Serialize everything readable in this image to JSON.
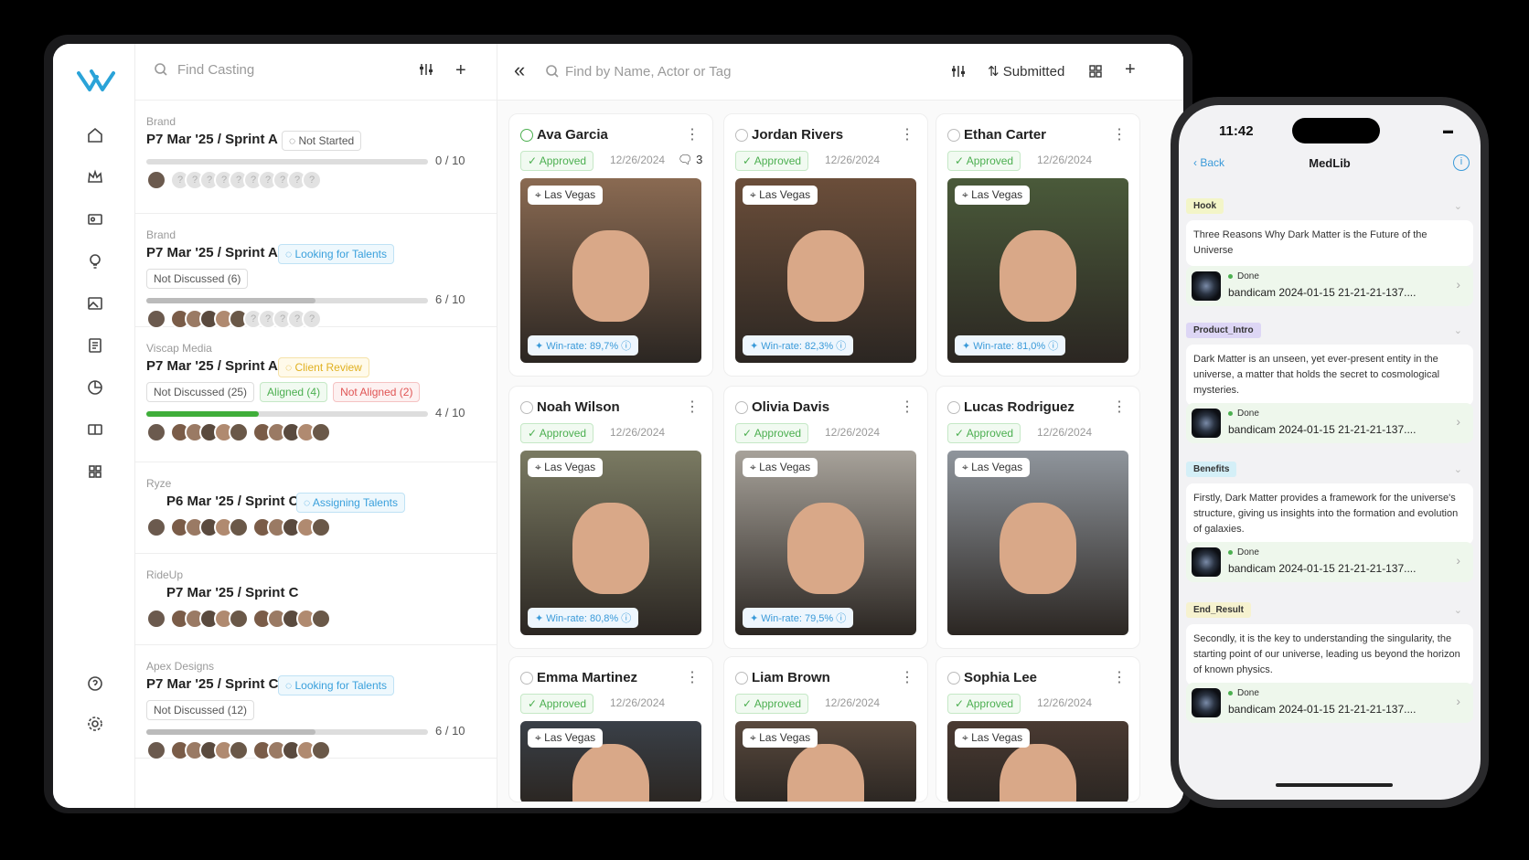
{
  "left_search": {
    "placeholder": "Find Casting"
  },
  "main_search": {
    "placeholder": "Find by Name, Actor or Tag"
  },
  "sort_label": "Submitted",
  "projects": [
    {
      "brand": "Brand",
      "title": "P7 Mar '25 / Sprint A",
      "status": "Not Started",
      "status_style": "plain",
      "tags": [],
      "progress": 0.0,
      "count": "0 / 10"
    },
    {
      "brand": "Brand",
      "title": "P7 Mar '25 / Sprint A",
      "status": "Looking for Talents",
      "status_style": "blue",
      "tags": [
        {
          "label": "Not Discussed (6)",
          "style": "plain"
        }
      ],
      "progress": 0.6,
      "count": "6 / 10"
    },
    {
      "brand": "Viscap Media",
      "title": "P7 Mar '25 / Sprint A",
      "status": "Client Review",
      "status_style": "yellow",
      "tags": [
        {
          "label": "Not Discussed (25)",
          "style": "plain"
        },
        {
          "label": "Aligned (4)",
          "style": "green"
        },
        {
          "label": "Not Aligned (2)",
          "style": "red"
        }
      ],
      "progress": 0.4,
      "count": "4 / 10"
    },
    {
      "brand": "Ryze",
      "title": "P6 Mar '25 / Sprint C",
      "status": "Assigning Talents",
      "status_style": "blue",
      "tags": [],
      "progress": null,
      "count": ""
    },
    {
      "brand": "RideUp",
      "title": "P7 Mar '25 / Sprint C",
      "status": "",
      "status_style": "",
      "tags": [],
      "progress": null,
      "count": ""
    },
    {
      "brand": "Apex Designs",
      "title": "P7 Mar '25 / Sprint C",
      "status": "Looking for Talents",
      "status_style": "blue",
      "tags": [
        {
          "label": "Not Discussed (12)",
          "style": "plain"
        }
      ],
      "progress": 0.6,
      "count": "6 / 10"
    }
  ],
  "talents": [
    {
      "name": "Ava Garcia",
      "status": "Approved",
      "date": "12/26/2024",
      "comments": "3",
      "location": "Las Vegas",
      "winrate": "Win-rate: 89,7%",
      "photo_color": "#8a6a52"
    },
    {
      "name": "Jordan Rivers",
      "status": "Approved",
      "date": "12/26/2024",
      "comments": "",
      "location": "Las Vegas",
      "winrate": "Win-rate: 82,3%",
      "photo_color": "#6b4e3a"
    },
    {
      "name": "Ethan Carter",
      "status": "Approved",
      "date": "12/26/2024",
      "comments": "",
      "location": "Las Vegas",
      "winrate": "Win-rate: 81,0%",
      "photo_color": "#4a5a3a"
    },
    {
      "name": "Noah Wilson",
      "status": "Approved",
      "date": "12/26/2024",
      "comments": "",
      "location": "Las Vegas",
      "winrate": "Win-rate: 80,8%",
      "photo_color": "#7a7a62"
    },
    {
      "name": "Olivia Davis",
      "status": "Approved",
      "date": "12/26/2024",
      "comments": "",
      "location": "Las Vegas",
      "winrate": "Win-rate: 79,5%",
      "photo_color": "#a7a29a"
    },
    {
      "name": "Lucas Rodriguez",
      "status": "Approved",
      "date": "12/26/2024",
      "comments": "",
      "location": "Las Vegas",
      "winrate": "",
      "photo_color": "#8f959c"
    },
    {
      "name": "Emma Martinez",
      "status": "Approved",
      "date": "12/26/2024",
      "comments": "",
      "location": "Las Vegas",
      "winrate": "",
      "photo_color": "#3a4048"
    },
    {
      "name": "Liam Brown",
      "status": "Approved",
      "date": "12/26/2024",
      "comments": "",
      "location": "Las Vegas",
      "winrate": "",
      "photo_color": "#5a4a3e"
    },
    {
      "name": "Sophia Lee",
      "status": "Approved",
      "date": "12/26/2024",
      "comments": "",
      "location": "Las Vegas",
      "winrate": "",
      "photo_color": "#4a3a32"
    }
  ],
  "phone": {
    "time": "11:42",
    "back": "Back",
    "title": "MedLib",
    "sections": [
      {
        "tag": "Hook",
        "tag_color": "#f3f5c8",
        "text": "Three Reasons Why Dark Matter is the Future of the Universe",
        "done": "Done",
        "file": "bandicam 2024-01-15 21-21-21-137...."
      },
      {
        "tag": "Product_Intro",
        "tag_color": "#ddd6f5",
        "text": "Dark Matter is an unseen, yet ever-present entity in the universe, a matter that holds the secret to cosmological mysteries.",
        "done": "Done",
        "file": "bandicam 2024-01-15 21-21-21-137...."
      },
      {
        "tag": "Benefits",
        "tag_color": "#d4eff7",
        "text": "Firstly, Dark Matter provides a framework for the universe's structure, giving us insights into the formation and evolution of galaxies.",
        "done": "Done",
        "file": "bandicam 2024-01-15 21-21-21-137...."
      },
      {
        "tag": "End_Result",
        "tag_color": "#f6f2cf",
        "text": "Secondly, it is the key to understanding the singularity, the starting point of our universe, leading us beyond the horizon of known physics.",
        "done": "Done",
        "file": "bandicam 2024-01-15 21-21-21-137...."
      }
    ]
  },
  "colors": {
    "accent": "#3a9ad9",
    "approved": "#4caf50",
    "progress_green": "#3fae3a"
  }
}
